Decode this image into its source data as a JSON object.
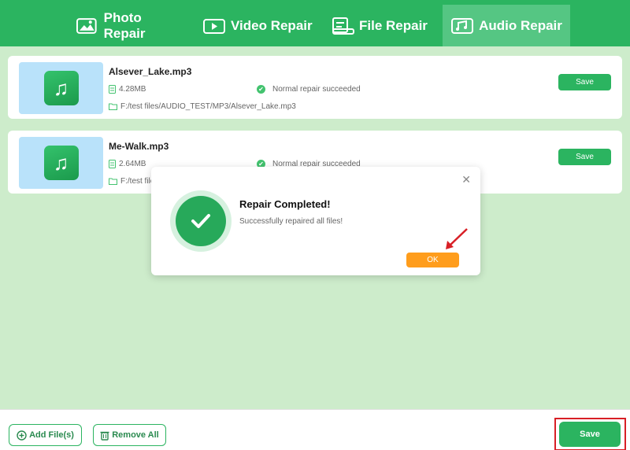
{
  "tabs": [
    {
      "label": "Photo Repair",
      "icon": "photo-icon"
    },
    {
      "label": "Video Repair",
      "icon": "video-icon"
    },
    {
      "label": "File Repair",
      "icon": "file-icon"
    },
    {
      "label": "Audio Repair",
      "icon": "audio-icon"
    }
  ],
  "active_tab": "Audio Repair",
  "files": [
    {
      "name": "Alsever_Lake.mp3",
      "size": "4.28MB",
      "status": "Normal repair succeeded",
      "path": "F:/test files/AUDIO_TEST/MP3/Alsever_Lake.mp3",
      "save_label": "Save"
    },
    {
      "name": "Me-Walk.mp3",
      "size": "2.64MB",
      "status": "Normal repair succeeded",
      "path": "F:/test file",
      "save_label": "Save"
    }
  ],
  "dialog": {
    "title": "Repair Completed!",
    "message": "Successfully repaired all files!",
    "ok_label": "OK",
    "close_glyph": "✕"
  },
  "bottom": {
    "add_label": "Add File(s)",
    "remove_label": "Remove All",
    "save_label": "Save"
  },
  "colors": {
    "brand_green": "#2bb460",
    "ok_orange": "#ff9d1c",
    "highlight_red": "#d81f26",
    "workspace_bg": "#cdeccb"
  }
}
